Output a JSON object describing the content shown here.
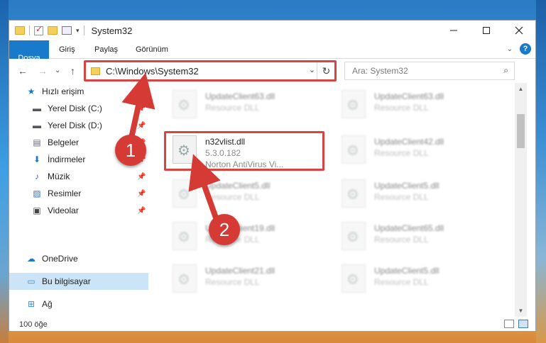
{
  "window": {
    "title": "System32",
    "minimize_icon": "minimize-icon",
    "maximize_icon": "maximize-icon",
    "close_icon": "close-icon"
  },
  "ribbon": {
    "tabs": [
      "Dosya",
      "Giriş",
      "Paylaş",
      "Görünüm"
    ],
    "help": "?"
  },
  "navigation": {
    "address": "C:\\Windows\\System32",
    "search_placeholder": "Ara: System32"
  },
  "sidebar": {
    "items": [
      {
        "label": "Hızlı erişim",
        "icon": "star-icon"
      },
      {
        "label": "Yerel Disk (C:)",
        "icon": "drive-icon"
      },
      {
        "label": "Yerel Disk (D:)",
        "icon": "drive-icon"
      },
      {
        "label": "Belgeler",
        "icon": "documents-icon"
      },
      {
        "label": "İndirmeler",
        "icon": "download-icon"
      },
      {
        "label": "Müzik",
        "icon": "music-icon"
      },
      {
        "label": "Resimler",
        "icon": "pictures-icon"
      },
      {
        "label": "Videolar",
        "icon": "videos-icon"
      },
      {
        "label": "OneDrive",
        "icon": "cloud-icon"
      },
      {
        "label": "Bu bilgisayar",
        "icon": "computer-icon"
      },
      {
        "label": "Ağ",
        "icon": "network-icon"
      }
    ]
  },
  "files": {
    "left": [
      {
        "name": "UpdateClient63.dll",
        "sub": "Resource DLL"
      },
      {
        "name": "n32vlist.dll",
        "version": "5.3.0.182",
        "sub": "Norton AntiVirus Vi..."
      },
      {
        "name": "UpdateClient5.dll",
        "sub": "Resource DLL"
      },
      {
        "name": "UpdateClient19.dll",
        "sub": "Resource DLL"
      },
      {
        "name": "UpdateClient21.dll",
        "sub": "Resource DLL"
      }
    ],
    "right": [
      {
        "name": "UpdateClient63.dll",
        "sub": "Resource DLL"
      },
      {
        "name": "UpdateClient42.dll",
        "sub": "Resource DLL"
      },
      {
        "name": "UpdateClient5.dll",
        "sub": "Resource DLL"
      },
      {
        "name": "UpdateClient65.dll",
        "sub": "Resource DLL"
      },
      {
        "name": "UpdateClient5.dll",
        "sub": "Resource DLL"
      }
    ]
  },
  "status": {
    "count": "100 öğe"
  },
  "callouts": [
    "1",
    "2"
  ],
  "colors": {
    "accent": "#1979ca",
    "highlight": "#d64541"
  }
}
